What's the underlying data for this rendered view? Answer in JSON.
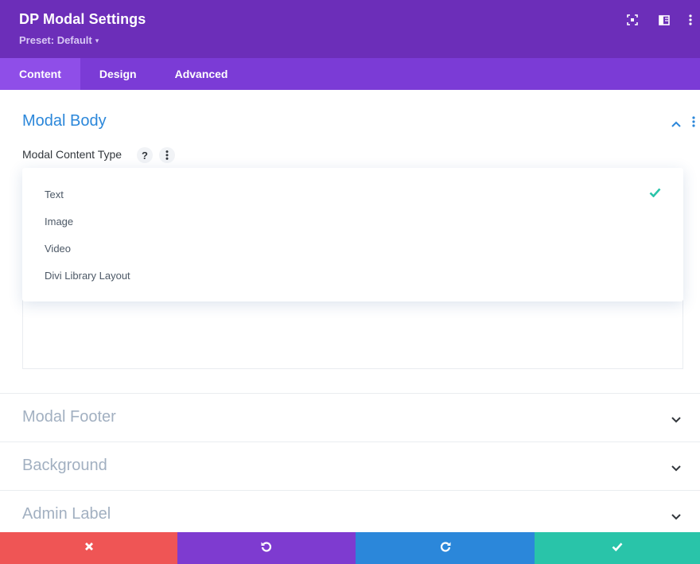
{
  "header": {
    "title": "DP Modal Settings",
    "preset_label": "Preset: Default",
    "background": "#6c2eb9",
    "icons": [
      "fullscreen-icon",
      "sidebar-layout-icon",
      "more-vertical-icon"
    ]
  },
  "tabs": [
    {
      "label": "Content",
      "active": true
    },
    {
      "label": "Design",
      "active": false
    },
    {
      "label": "Advanced",
      "active": false
    }
  ],
  "modal_body": {
    "title": "Modal Body",
    "field_label": "Modal Content Type",
    "help_symbol": "?",
    "dropdown": {
      "options": [
        "Text",
        "Image",
        "Video",
        "Divi Library Layout"
      ],
      "selected": "Text"
    }
  },
  "sections": [
    {
      "label": "Modal Footer"
    },
    {
      "label": "Background"
    },
    {
      "label": "Admin Label"
    }
  ],
  "footer": {
    "buttons": [
      {
        "name": "discard",
        "icon": "close-icon",
        "color": "#ef5555"
      },
      {
        "name": "undo",
        "icon": "undo-icon",
        "color": "#7e3bd0"
      },
      {
        "name": "redo",
        "icon": "redo-icon",
        "color": "#2b87da"
      },
      {
        "name": "save",
        "icon": "check-icon",
        "color": "#29c4a9"
      }
    ]
  },
  "colors": {
    "accent_blue": "#2b87da",
    "tab_bar": "#7b3bd6",
    "active_tab": "#8f4ee8",
    "check_green": "#29c4a9",
    "collapsed_label": "#a2b0c1"
  }
}
